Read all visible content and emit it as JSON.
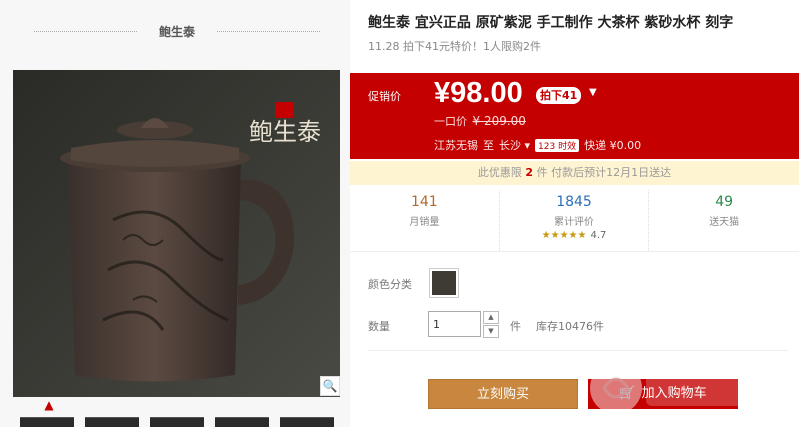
{
  "brand": {
    "name": "鲍生泰"
  },
  "product": {
    "title": "鲍生泰 宜兴正品 原矿紫泥 手工制作 大茶杯 紫砂水杯 刻字",
    "subtitle": "11.28 拍下41元特价！1人限购2件",
    "image_seal_text": "鲍生泰"
  },
  "price": {
    "label": "促销价",
    "value": "¥98.00",
    "badge": "拍下41",
    "original_label": "一口价",
    "original_value": "¥ 209.00"
  },
  "shipping": {
    "from": "江苏无锡",
    "to_word": "至",
    "to": "长沙",
    "tag": "123 时效",
    "express": "快递 ¥0.00"
  },
  "promo": {
    "prefix": "此优惠限",
    "limit": "2",
    "suffix": "件  付款后预计12月1日送达"
  },
  "stats": {
    "monthly_sales": {
      "value": "141",
      "label": "月销量"
    },
    "reviews": {
      "value": "1845",
      "label": "累计评价",
      "stars": "★★★★★",
      "score": "4.7"
    },
    "third": {
      "value": "49",
      "label": "送天猫"
    }
  },
  "options": {
    "color_label": "颜色分类",
    "qty_label": "数量",
    "qty_value": "1",
    "unit": "件",
    "stock": "库存10476件"
  },
  "actions": {
    "buy_now": "立刻购买",
    "add_cart": "加入购物车"
  },
  "colors": {
    "accent": "#c40000",
    "buy_now": "#c8863e",
    "promo_bg": "#fff4d2"
  }
}
